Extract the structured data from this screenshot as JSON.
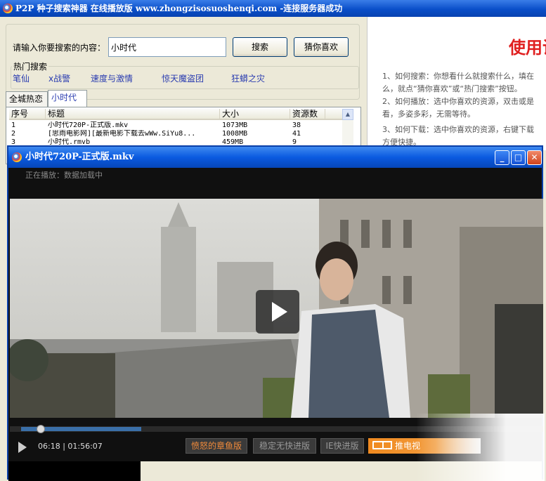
{
  "main_window": {
    "title": "P2P  种子搜索神器  在线播放版  www.zhongzisosuoshenqi.com -连接服务器成功"
  },
  "search": {
    "prompt_label": "请输入你要搜索的内容：",
    "input_value": "小时代",
    "search_button": "搜索",
    "guess_button": "猜你喜欢"
  },
  "hot": {
    "group_label": "热门搜索",
    "items": [
      "笔仙",
      "x战警",
      "速度与激情",
      "惊天魔盗团",
      "狂蟒之灾"
    ]
  },
  "tabs": [
    "全城热恋",
    "小时代"
  ],
  "table": {
    "columns": [
      "序号",
      "标题",
      "大小",
      "资源数"
    ],
    "rows": [
      {
        "no": "1",
        "title": "小时代720P-正式版.mkv",
        "size": "1073MB",
        "count": "38"
      },
      {
        "no": "2",
        "title": "[思雨电影网][最新电影下载去wWw.SiYu8...",
        "size": "1008MB",
        "count": "41"
      },
      {
        "no": "3",
        "title": "小时代.rmvb",
        "size": "459MB",
        "count": "9"
      }
    ]
  },
  "help": {
    "title": "使用说",
    "lines": [
      "1、如何搜索：你想看什么就搜索什么，填在",
      "么，就点“猜你喜欢”或“热门搜索”按钮。",
      "2、如何播放：选中你喜欢的资源，双击或是",
      "看，多姿多彩，无需等待。",
      "3、如何下载：选中你喜欢的资源，右键下载",
      "方便快捷。"
    ]
  },
  "player": {
    "title": "小时代720P-正式版.mkv",
    "status": "正在播放：数据加载中",
    "time": "06:18 | 01:56:07",
    "progress_fraction": 0.03,
    "buffer_fraction": 0.23,
    "buttons": [
      "愤怒的章鱼版",
      "稳定无快进版",
      "IE快进版"
    ],
    "tv_button": "推电视",
    "colors": {
      "octopus": "#f08a3a",
      "muted": "#8a8a8a",
      "tv": "#f08a20"
    }
  }
}
